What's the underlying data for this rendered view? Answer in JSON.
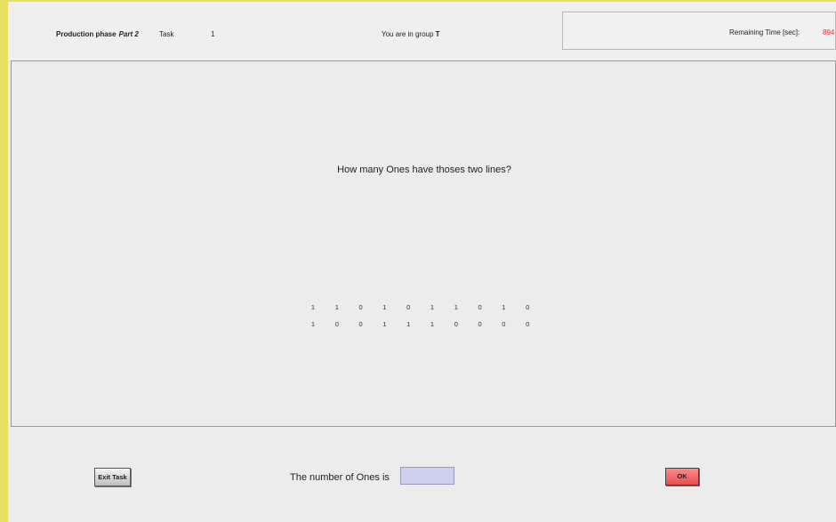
{
  "header": {
    "phase_label": "Production phase",
    "phase_part": "Part 2",
    "task_label": "Task",
    "task_number": "1",
    "group_prefix": "You are in group",
    "group_name": "T",
    "timer_label": "Remaining Time [sec]:",
    "timer_value": "894"
  },
  "task": {
    "question": "How many Ones have thoses two lines?",
    "rows": [
      [
        "1",
        "1",
        "0",
        "1",
        "0",
        "1",
        "1",
        "0",
        "1",
        "0"
      ],
      [
        "1",
        "0",
        "0",
        "1",
        "1",
        "1",
        "0",
        "0",
        "0",
        "0"
      ]
    ]
  },
  "footer": {
    "exit_label": "Exit Task",
    "answer_label": "The number of Ones is",
    "answer_value": "",
    "ok_label": "OK"
  },
  "colors": {
    "frame_accent": "#e8e063",
    "timer_value": "#e03030",
    "input_bg": "#cfd0ee",
    "ok_button": "#ea4d4d"
  }
}
